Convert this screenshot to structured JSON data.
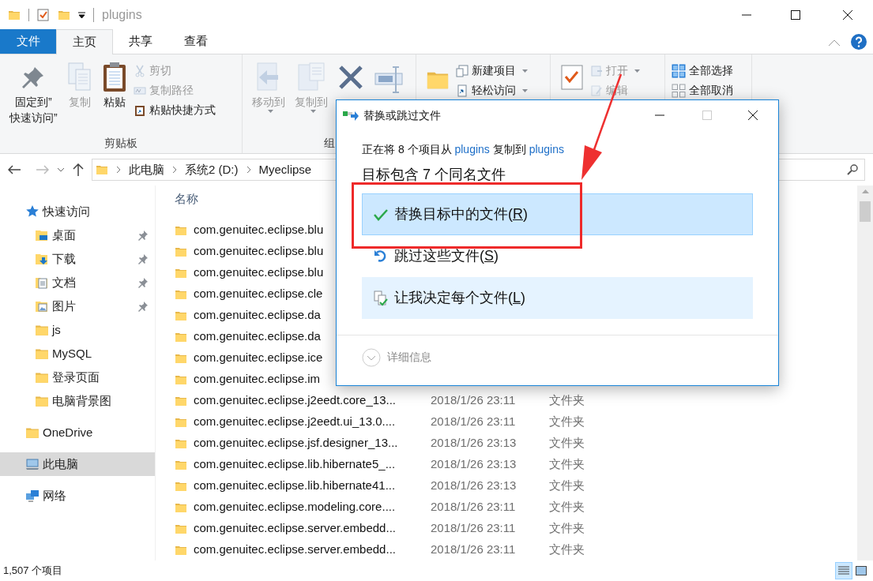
{
  "title_bar": {
    "title": "plugins"
  },
  "ribbon_tabs": [
    {
      "label": "文件",
      "kind": "file",
      "selected": false
    },
    {
      "label": "主页",
      "kind": "tab",
      "selected": true
    },
    {
      "label": "共享",
      "kind": "tab",
      "selected": false
    },
    {
      "label": "查看",
      "kind": "tab",
      "selected": false
    }
  ],
  "ribbon_groups": [
    {
      "label": "剪贴板",
      "items": [
        {
          "kind": "large",
          "label": "固定到”\n快速访问”",
          "disabled": false,
          "dropdown": false
        },
        {
          "kind": "large",
          "label": "复制",
          "disabled": true,
          "dropdown": false
        },
        {
          "kind": "large",
          "label": "粘贴",
          "disabled": false,
          "dropdown": false
        },
        {
          "kind": "small",
          "label": "剪切",
          "disabled": true,
          "dropdown": false
        },
        {
          "kind": "small",
          "label": "复制路径",
          "disabled": true,
          "dropdown": false
        },
        {
          "kind": "small",
          "label": "粘贴快捷方式",
          "disabled": false,
          "dropdown": false
        }
      ]
    },
    {
      "label": "组",
      "items": [
        {
          "kind": "large",
          "label": "移动到",
          "disabled": true,
          "dropdown": true
        },
        {
          "kind": "large",
          "label": "复制到",
          "disabled": true,
          "dropdown": true
        },
        {
          "kind": "icon"
        },
        {
          "kind": "icon"
        }
      ]
    },
    {
      "items": [
        {
          "kind": "icon"
        },
        {
          "kind": "small",
          "label": "新建项目",
          "disabled": false,
          "dropdown": true
        },
        {
          "kind": "small",
          "label": "轻松访问",
          "disabled": false,
          "dropdown": true
        }
      ]
    },
    {
      "items": [
        {
          "kind": "icon"
        },
        {
          "kind": "small",
          "label": "打开",
          "disabled": true,
          "dropdown": true
        },
        {
          "kind": "small",
          "label": "编辑",
          "disabled": true,
          "dropdown": false
        }
      ]
    },
    {
      "items": [
        {
          "kind": "small",
          "label": "全部选择",
          "disabled": false,
          "dropdown": false
        },
        {
          "kind": "small",
          "label": "全部取消",
          "disabled": false,
          "dropdown": false
        }
      ]
    }
  ],
  "address_bar": {
    "path": [
      "此电脑",
      "系统2 (D:)",
      "Myeclipse"
    ]
  },
  "navigation": [
    {
      "label": "快速访问",
      "kind": "star",
      "pinned": false,
      "selected": false,
      "children": [
        {
          "label": "桌面",
          "kind": "desktop",
          "pinned": true,
          "selected": false
        },
        {
          "label": "下载",
          "kind": "download",
          "pinned": true,
          "selected": false
        },
        {
          "label": "文档",
          "kind": "documents",
          "pinned": true,
          "selected": false
        },
        {
          "label": "图片",
          "kind": "pictures",
          "pinned": true,
          "selected": false
        },
        {
          "label": "js",
          "kind": "folder",
          "pinned": false,
          "selected": false
        },
        {
          "label": "MySQL",
          "kind": "folder",
          "pinned": false,
          "selected": false
        },
        {
          "label": "登录页面",
          "kind": "folder",
          "pinned": false,
          "selected": false
        },
        {
          "label": "电脑背景图",
          "kind": "folder",
          "pinned": false,
          "selected": false
        }
      ]
    },
    {
      "label": "OneDrive",
      "kind": "cloud",
      "pinned": false,
      "selected": false
    },
    {
      "label": "此电脑",
      "kind": "computer",
      "pinned": false,
      "selected": true
    },
    {
      "label": "网络",
      "kind": "network",
      "pinned": false,
      "selected": false
    }
  ],
  "file_list": {
    "columns": [
      "名称"
    ],
    "rows": [
      {
        "name": "com.genuitec.eclipse.blu"
      },
      {
        "name": "com.genuitec.eclipse.blu"
      },
      {
        "name": "com.genuitec.eclipse.blu"
      },
      {
        "name": "com.genuitec.eclipse.cle"
      },
      {
        "name": "com.genuitec.eclipse.da"
      },
      {
        "name": "com.genuitec.eclipse.da"
      },
      {
        "name": "com.genuitec.eclipse.ice"
      },
      {
        "name": "com.genuitec.eclipse.im"
      },
      {
        "name": "com.genuitec.eclipse.j2eedt.core_13...",
        "date": "2018/1/26 23:11",
        "type": "文件夹"
      },
      {
        "name": "com.genuitec.eclipse.j2eedt.ui_13.0....",
        "date": "2018/1/26 23:11",
        "type": "文件夹"
      },
      {
        "name": "com.genuitec.eclipse.jsf.designer_13...",
        "date": "2018/1/26 23:13",
        "type": "文件夹"
      },
      {
        "name": "com.genuitec.eclipse.lib.hibernate5_...",
        "date": "2018/1/26 23:13",
        "type": "文件夹"
      },
      {
        "name": "com.genuitec.eclipse.lib.hibernate41...",
        "date": "2018/1/26 23:13",
        "type": "文件夹"
      },
      {
        "name": "com.genuitec.eclipse.modeling.core....",
        "date": "2018/1/26 23:11",
        "type": "文件夹"
      },
      {
        "name": "com.genuitec.eclipse.server.embedd...",
        "date": "2018/1/26 23:11",
        "type": "文件夹"
      },
      {
        "name": "com.genuitec.eclipse.server.embedd...",
        "date": "2018/1/26 23:11",
        "type": "文件夹"
      }
    ]
  },
  "status_bar": {
    "item_count": "1,507 个项目",
    "views": [
      {
        "kind": "details",
        "selected": true
      },
      {
        "kind": "thumbnails",
        "selected": false
      }
    ]
  },
  "dialog": {
    "title": "替换或跳过文件",
    "message": [
      {
        "kind": "text",
        "text": "正在将 8 个项目从 "
      },
      {
        "kind": "link",
        "text": "plugins"
      },
      {
        "kind": "text",
        "text": " 复制到 "
      },
      {
        "kind": "link",
        "text": "plugins"
      }
    ],
    "heading": "目标包含 7 个同名文件",
    "options": [
      {
        "kind": "replace",
        "before": "替换目标中的文件(",
        "access_key": "R",
        "after": ")",
        "selected": true,
        "hovered": false
      },
      {
        "kind": "skip",
        "before": "跳过这些文件(",
        "access_key": "S",
        "after": ")",
        "selected": false,
        "hovered": false
      },
      {
        "kind": "decide",
        "before": "让我决定每个文件(",
        "access_key": "L",
        "after": ")",
        "selected": false,
        "hovered": true
      }
    ],
    "details": {
      "label": "详细信息",
      "expanded": false
    }
  }
}
